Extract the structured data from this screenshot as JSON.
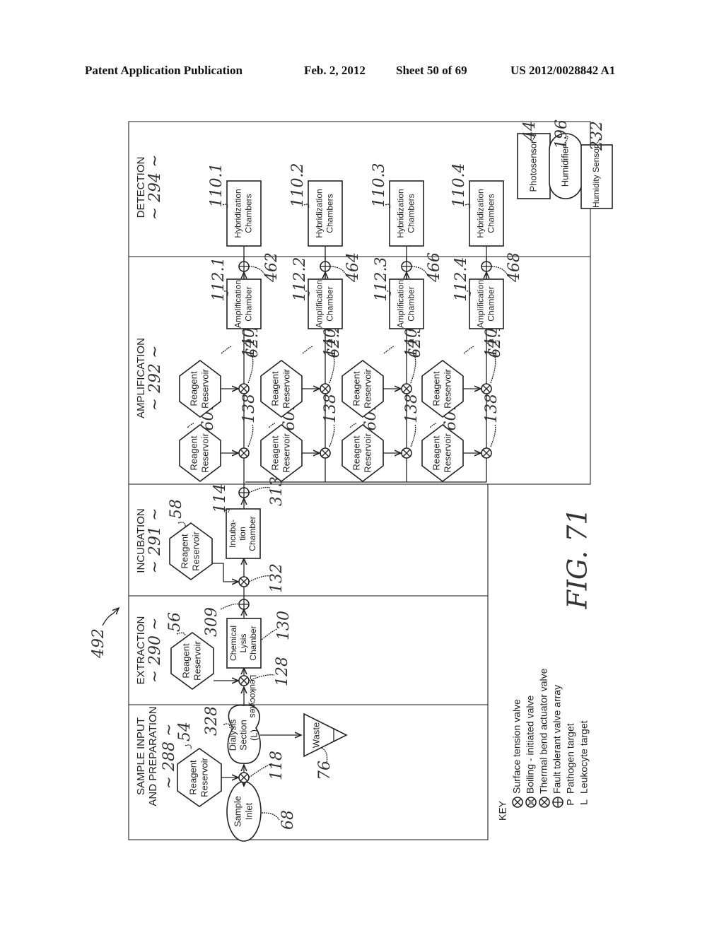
{
  "header": {
    "publication": "Patent Application Publication",
    "date": "Feb. 2, 2012",
    "sheet": "Sheet 50 of 69",
    "number": "US 2012/0028842 A1"
  },
  "figure": {
    "label": "FIG. 71",
    "ref": "492",
    "sections": [
      {
        "title": "SAMPLE INPUT",
        "title2": "AND PREPARATION",
        "ref": "~ 288 ~"
      },
      {
        "title": "EXTRACTION",
        "ref": "~ 290 ~"
      },
      {
        "title": "INCUBATION",
        "ref": "~ 291 ~"
      },
      {
        "title": "AMPLIFICATION",
        "ref": "~ 292 ~"
      },
      {
        "title": "DETECTION",
        "ref": "~ 294 ~"
      }
    ],
    "sample": {
      "inlet": {
        "l1": "Sample",
        "l2": "Inlet",
        "ref": "68"
      },
      "reservoir": {
        "l1": "Reagent",
        "l2": "Reservoir",
        "ref": "54"
      },
      "valve_ref": "118",
      "dialysis": {
        "l1": "Dialysis",
        "l2": "Section",
        "l3": "(L)",
        "ref": "328"
      },
      "waste": {
        "label": "Waste",
        "ref": "76"
      },
      "flow_label": "Leukocytes"
    },
    "extraction": {
      "reservoir": {
        "l1": "Reagent",
        "l2": "Reservoir",
        "ref": "56"
      },
      "valve_ref": "128",
      "chamber": {
        "l1": "Chemical",
        "l2": "Lysis",
        "l3": "Chamber",
        "ref": "130"
      },
      "ft_valve_ref": "309"
    },
    "incubation": {
      "reservoir": {
        "l1": "Reagent",
        "l2": "Reservoir",
        "ref": "58"
      },
      "valve_ref": "132",
      "chamber": {
        "l1": "Incuba-",
        "l2": "tion",
        "l3": "Chamber",
        "ref": "114"
      },
      "ft_valve_ref": "313"
    },
    "amplification": {
      "rows": [
        {
          "res_a": "60.1",
          "res_b": "62.1",
          "valve_a": "138",
          "valve_b": "140",
          "chamber": "112.1",
          "ft": "462"
        },
        {
          "res_a": "60.2",
          "res_b": "62.2",
          "valve_a": "138",
          "valve_b": "140",
          "chamber": "112.2",
          "ft": "464"
        },
        {
          "res_a": "60.3",
          "res_b": "62.3",
          "valve_a": "138",
          "valve_b": "140",
          "chamber": "112.3",
          "ft": "466"
        },
        {
          "res_a": "60.4",
          "res_b": "62.4",
          "valve_a": "138",
          "valve_b": "140",
          "chamber": "112.4",
          "ft": "468"
        }
      ],
      "reservoir_l1": "Reagent",
      "reservoir_l2": "Reservoir",
      "chamber_l1": "Amplification",
      "chamber_l2": "Chamber"
    },
    "detection": {
      "chambers": [
        "110.1",
        "110.2",
        "110.3",
        "110.4"
      ],
      "chamber_l1": "Hybridization",
      "chamber_l2": "Chambers",
      "photosensor": {
        "label": "Photosensor",
        "ref": "44"
      },
      "humidifier": {
        "label": "Humidifier",
        "ref": "196"
      },
      "humidity_sensor": {
        "label": "Humidity Sensor",
        "ref": "232"
      }
    },
    "key": {
      "title": "KEY",
      "items": [
        {
          "symbol": "surface-tension-valve",
          "label": "Surface tension valve"
        },
        {
          "symbol": "boiling-initiated-valve",
          "label": "Boiling - initiated valve"
        },
        {
          "symbol": "thermal-bend-actuator-valve",
          "label": "Thermal bend actuator valve"
        },
        {
          "symbol": "fault-tolerant-valve-array",
          "label": "Fault tolerant valve array"
        },
        {
          "symbol": "P",
          "label": "Pathogen target"
        },
        {
          "symbol": "L",
          "label": "Leukocyte target"
        }
      ]
    }
  }
}
